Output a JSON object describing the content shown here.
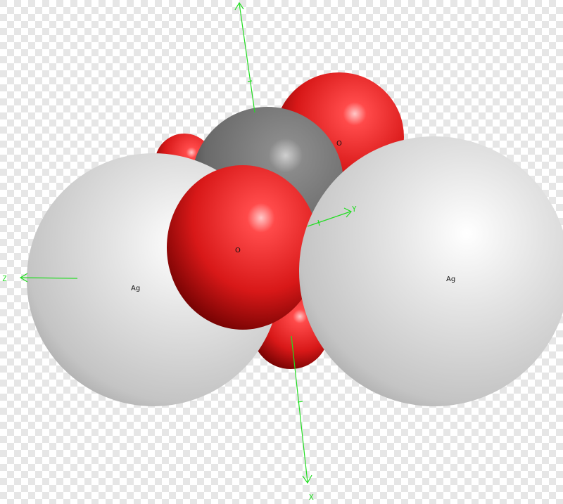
{
  "background": {
    "checker_light": "#ffffff",
    "checker_dark": "#e6e6e6"
  },
  "atoms": [
    {
      "element": "O",
      "label": "",
      "color": "#e02020"
    },
    {
      "element": "O",
      "label": "",
      "color": "#e02020"
    },
    {
      "element": "O",
      "label": "O",
      "color": "#e02020"
    },
    {
      "element": "C",
      "label": "",
      "color": "#7a7a7a"
    },
    {
      "element": "Ag",
      "label": "Ag",
      "color": "#d9d9d9"
    },
    {
      "element": "O",
      "label": "O",
      "color": "#e02020"
    },
    {
      "element": "Ag",
      "label": "Ag",
      "color": "#d9d9d9"
    }
  ],
  "axes": {
    "x": {
      "label": "X"
    },
    "y": {
      "label": "Y"
    },
    "z": {
      "label": "Z"
    },
    "color": "#22dd22"
  }
}
